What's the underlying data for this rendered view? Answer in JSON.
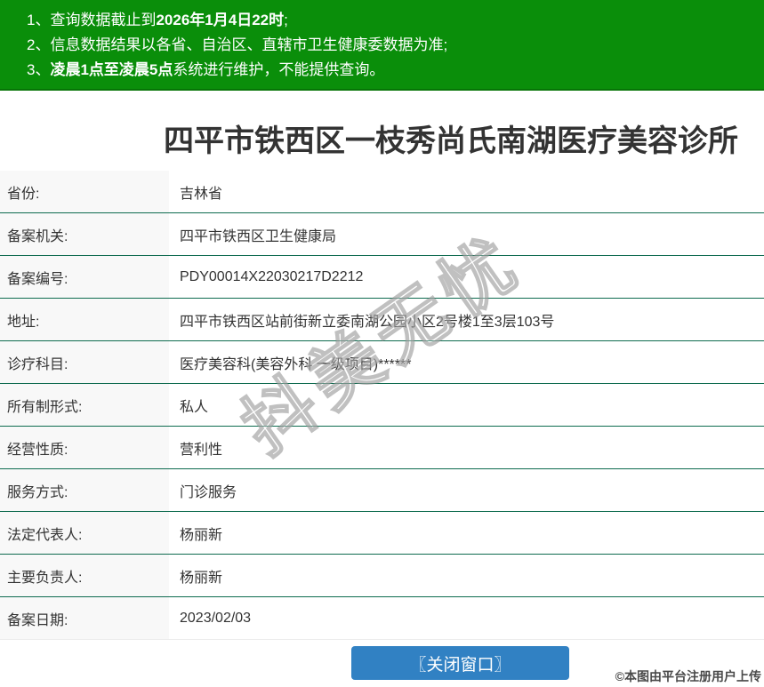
{
  "notices": [
    {
      "prefix": "1、查询数据截止到",
      "bold": "2026年1月4日22时",
      "suffix": ";"
    },
    {
      "prefix": "2、信息数据结果以各省、自治区、直辖市卫生健康委数据为准;",
      "bold": "",
      "suffix": ""
    },
    {
      "prefix": "3、",
      "bold": "凌晨1点至凌晨5点",
      "suffix": "系统进行维护，不能提供查询。"
    }
  ],
  "title": "四平市铁西区一枝秀尚氏南湖医疗美容诊所",
  "table": {
    "rows": [
      {
        "label": "省份:",
        "value": "吉林省"
      },
      {
        "label": "备案机关:",
        "value": "四平市铁西区卫生健康局"
      },
      {
        "label": "备案编号:",
        "value": "PDY00014X22030217D2212"
      },
      {
        "label": "地址:",
        "value": "四平市铁西区站前街新立委南湖公园小区2号楼1至3层103号"
      },
      {
        "label": "诊疗科目:",
        "value": "医疗美容科(美容外科 一级项目)******"
      },
      {
        "label": "所有制形式:",
        "value": "私人"
      },
      {
        "label": "经营性质:",
        "value": "营利性"
      },
      {
        "label": "服务方式:",
        "value": "门诊服务"
      },
      {
        "label": "法定代表人:",
        "value": "杨丽新"
      },
      {
        "label": "主要负责人:",
        "value": "杨丽新"
      },
      {
        "label": "备案日期:",
        "value": "2023/02/03"
      }
    ]
  },
  "close_button": {
    "label": "〖关闭窗口〗"
  },
  "watermarks": {
    "diagonal": "抖美无忧",
    "credit": "©本图由平台注册用户上传"
  },
  "colors": {
    "header_green": "#0a8e0a",
    "separator_green": "#0e6b4f",
    "label_bg": "#f8f8f8",
    "button_blue": "#3181c3"
  }
}
